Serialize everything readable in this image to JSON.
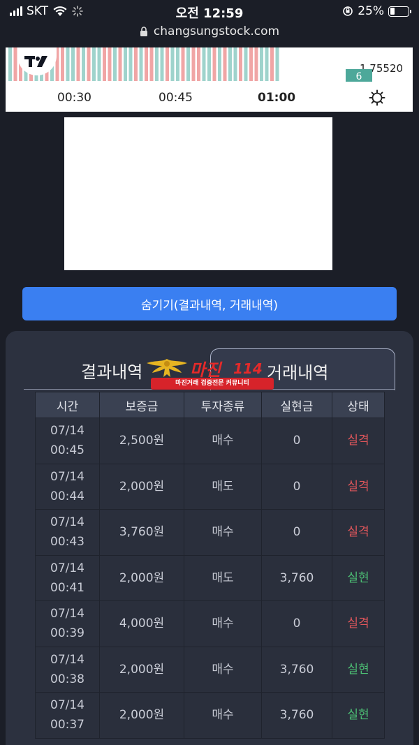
{
  "status_bar": {
    "carrier": "SKT",
    "time": "오전 12:59",
    "battery": "25%",
    "battery_level": 0.25
  },
  "browser": {
    "url": "changsungstock.com"
  },
  "chart": {
    "price": "1.75520",
    "badge": "6",
    "times": [
      "00:30",
      "00:45",
      "01:00"
    ]
  },
  "toggle_button": {
    "label": "숨기기(결과내역, 거래내역)"
  },
  "tabs": {
    "result": "결과내역",
    "trade": "거래내역"
  },
  "watermark": {
    "title": "마진",
    "number": "114",
    "subtitle": "마진거래 검증전문 커뮤니티"
  },
  "table": {
    "headers": [
      "시간",
      "보증금",
      "투자종류",
      "실현금",
      "상태"
    ],
    "rows": [
      {
        "date": "07/14",
        "time": "00:45",
        "deposit": "2,500원",
        "type": "매수",
        "realized": "0",
        "status": "실격"
      },
      {
        "date": "07/14",
        "time": "00:44",
        "deposit": "2,000원",
        "type": "매도",
        "realized": "0",
        "status": "실격"
      },
      {
        "date": "07/14",
        "time": "00:43",
        "deposit": "3,760원",
        "type": "매수",
        "realized": "0",
        "status": "실격"
      },
      {
        "date": "07/14",
        "time": "00:41",
        "deposit": "2,000원",
        "type": "매도",
        "realized": "3,760",
        "status": "실현"
      },
      {
        "date": "07/14",
        "time": "00:39",
        "deposit": "4,000원",
        "type": "매수",
        "realized": "0",
        "status": "실격"
      },
      {
        "date": "07/14",
        "time": "00:38",
        "deposit": "2,000원",
        "type": "매수",
        "realized": "3,760",
        "status": "실현"
      },
      {
        "date": "07/14",
        "time": "00:37",
        "deposit": "2,000원",
        "type": "매수",
        "realized": "3,760",
        "status": "실현"
      }
    ]
  },
  "colors": {
    "accent": "#3a7ff1",
    "loss": "#e0565b",
    "win": "#4cbf74",
    "candle_up": "#9fd3cc",
    "candle_down": "#f0a5a5"
  }
}
